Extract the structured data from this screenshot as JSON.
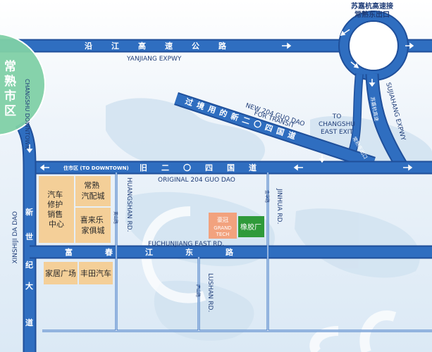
{
  "district": {
    "name_cn": "常熟市区",
    "name_en": "CHANGSHU DOWNTOWN"
  },
  "exit_title": {
    "line1": "苏嘉杭高速接",
    "line2": "常熟东出口"
  },
  "roads": {
    "yanjiang": {
      "cn": "沿江高速公路",
      "en": "YANJIANG EXPWY"
    },
    "sujiahang": {
      "en": "SUJIAHANG EXPWY",
      "cn_small": "苏嘉杭高速"
    },
    "new204": {
      "cn": "过境用的新二〇四国道",
      "en_line1": "NEW 204 GUO DAO",
      "en_line2": "FOR TRANSIT"
    },
    "old204": {
      "cn": "旧二〇四国道",
      "en": "ORIGINAL 204 GUO DAO"
    },
    "to_downtown": "住市区 (TO DOWNTOWN)",
    "to_exit": {
      "line1": "TO",
      "line2": "CHANGSHU",
      "line3": "EAST EXIT"
    },
    "exit_sign": "常熟东出口",
    "fuchunjiang": {
      "cn": "富春江东路",
      "en": "FUCHUNJIANG EAST RD."
    },
    "xinshiji": {
      "cn": "新世纪大道",
      "en": "XINSHIJI DA DAO"
    },
    "huangshan": {
      "en": "HUANGSHAN RD.",
      "cn": "黄山路"
    },
    "jinhua": {
      "en": "JINHUA RD.",
      "cn": "金华路"
    },
    "lushan": {
      "en": "LUSHAN RD.",
      "cn": "庐山路"
    }
  },
  "blocks": {
    "car_repair": [
      "汽车",
      "修护",
      "销售",
      "中心"
    ],
    "auto_parts": [
      "常熟",
      "汽配城"
    ],
    "furniture": [
      "喜来乐",
      "家俱城"
    ],
    "home_plaza": "家居广场",
    "toyota": "丰田汽车",
    "grand_tech": {
      "cn": "豪冠",
      "en_line1": "GRAND",
      "en_line2": "TECH"
    },
    "rubber_factory": "橡胶厂"
  },
  "colors": {
    "road": "#2f6ec0",
    "road_edge": "#1f4f9a",
    "block_tan": "#f4cf98",
    "grand_tech": "#f2a27e",
    "rubber": "#2f9a3a",
    "district_green": "#7fd0a6"
  }
}
